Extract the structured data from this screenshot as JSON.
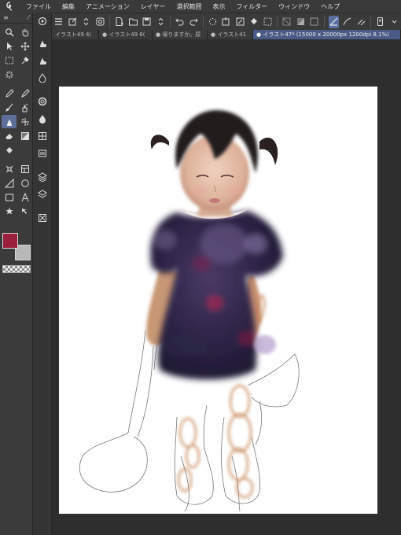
{
  "app": {
    "logo": "clip-studio-logo"
  },
  "menu": {
    "items": [
      "ファイル",
      "編集",
      "アニメーション",
      "レイヤー",
      "選択範囲",
      "表示",
      "フィルター",
      "ウィンドウ",
      "ヘルプ"
    ]
  },
  "tabs": [
    {
      "label": "イラスト49 4("
    },
    {
      "label": "● イラスト49 6("
    },
    {
      "label": "● 帰りますか。原"
    },
    {
      "label": "● イラスト41"
    },
    {
      "label": "● イラスト47* (15000 x 20000px 1200dpi 8.1%)"
    }
  ],
  "tool_panel": {
    "header_icon": "menu-icon"
  },
  "colors": {
    "foreground": "#9a1f3d",
    "background": "#b8b8b8"
  }
}
